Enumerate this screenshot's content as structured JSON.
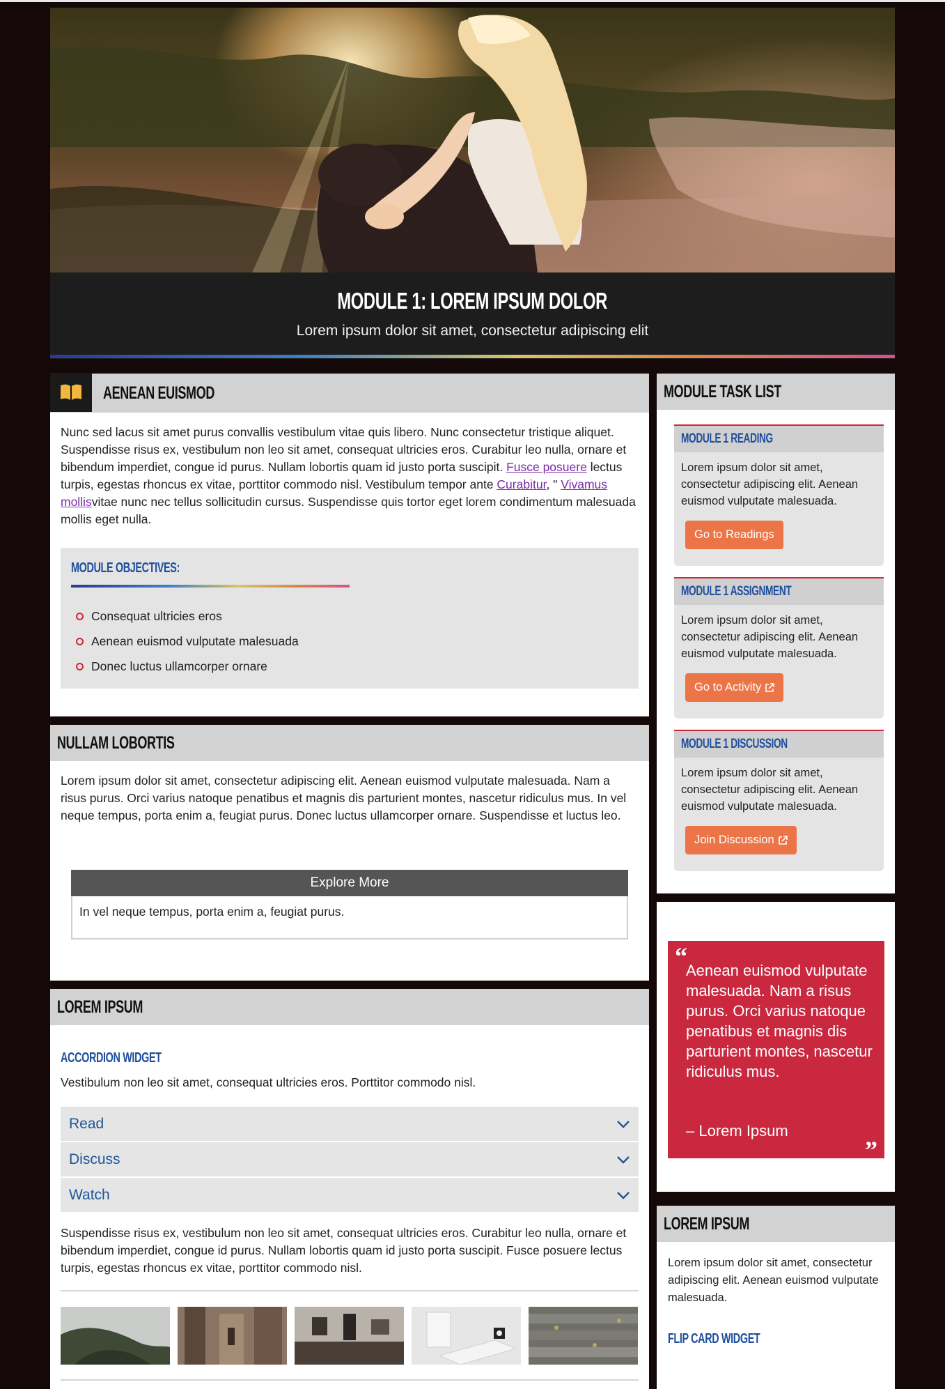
{
  "hero": {
    "title": "MODULE 1: LOREM IPSUM DOLOR",
    "subtitle": "Lorem ipsum dolor sit amet, consectetur adipiscing elit"
  },
  "section1": {
    "title": "AENEAN EUISMOD",
    "text_1": "Nunc sed lacus sit amet purus convallis vestibulum vitae quis libero. Nunc consectetur tristique aliquet. Suspendisse risus ex, vestibulum non leo sit amet, consequat ultricies eros. Curabitur leo nulla, ornare et bibendum imperdiet, congue id purus. Nullam lobortis quam id justo porta suscipit. ",
    "link_1": "Fusce posuere",
    "text_2": " lectus turpis, egestas rhoncus ex vitae, porttitor commodo nisl. Vestibulum tempor ante ",
    "link_2": "Curabitur",
    "text_3": ", \" ",
    "link_3": "Vivamus mollis",
    "text_4": "vitae nunc nec tellus sollicitudin cursus. Suspendisse quis tortor eget lorem condimentum malesuada mollis eget nulla.",
    "objectives_title": "MODULE OBJECTIVES:",
    "objectives": [
      "Consequat ultricies eros",
      "Aenean euismod vulputate malesuada",
      "Donec luctus ullamcorper ornare"
    ]
  },
  "section2": {
    "title": "NULLAM LOBORTIS",
    "text": "Lorem ipsum dolor sit amet, consectetur adipiscing elit. Aenean euismod vulputate malesuada. Nam a risus purus. Orci varius natoque penatibus et magnis dis parturient montes, nascetur ridiculus mus. In vel neque tempus, porta enim a, feugiat purus. Donec luctus ullamcorper ornare. Suspendisse et luctus leo.",
    "explore_title": "Explore More",
    "explore_text": "In vel neque tempus, porta enim a, feugiat purus."
  },
  "section3": {
    "title": "LOREM IPSUM",
    "accordion_title": "ACCORDION WIDGET",
    "accordion_intro": "Vestibulum non leo sit amet, consequat ultricies eros. Porttitor commodo nisl.",
    "accordion_items": [
      "Read",
      "Discuss",
      "Watch"
    ],
    "after_text": "Suspendisse risus ex, vestibulum non leo sit amet, consequat ultricies eros. Curabitur leo nulla, ornare et bibendum imperdiet, congue id purus. Nullam lobortis quam id justo porta suscipit. Fusce posuere lectus turpis, egestas rhoncus ex vitae, porttitor commodo nisl."
  },
  "tasks": {
    "title": "MODULE TASK LIST",
    "items": [
      {
        "title": "MODULE 1 READING",
        "text": "Lorem ipsum dolor sit amet, consectetur adipiscing elit. Aenean euismod vulputate malesuada.",
        "button": "Go to Readings"
      },
      {
        "title": "MODULE 1 ASSIGNMENT",
        "text": "Lorem ipsum dolor sit amet, consectetur adipiscing elit. Aenean euismod vulputate malesuada.",
        "button": "Go to Activity"
      },
      {
        "title": "MODULE 1 DISCUSSION",
        "text": "Lorem ipsum dolor sit amet, consectetur adipiscing elit. Aenean euismod vulputate malesuada.",
        "button": "Join Discussion"
      }
    ]
  },
  "quote": {
    "text": "Aenean euismod vulputate malesuada. Nam a risus purus. Orci varius natoque penatibus et magnis dis parturient montes, nascetur ridiculus mus.",
    "author": "– Lorem Ipsum"
  },
  "side3": {
    "title": "LOREM IPSUM",
    "text": "Lorem ipsum dolor sit amet, consectetur adipiscing elit. Aenean euismod vulputate malesuada.",
    "flip_title": "FLIP CARD WIDGET"
  },
  "colors": {
    "accent_blue": "#1f4f9c",
    "accent_red": "#c9283f",
    "button_orange": "#ec7548"
  },
  "icons": [
    "book-icon",
    "bullet-icon",
    "chevron-down-icon",
    "external-link-icon",
    "quote-open-icon",
    "quote-close-icon"
  ]
}
